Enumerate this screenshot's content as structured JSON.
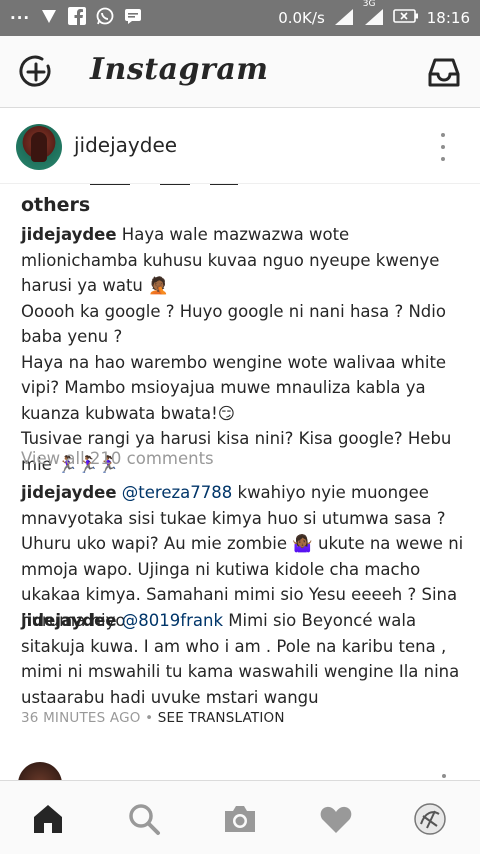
{
  "status_bar": {
    "left_icons": [
      "more-dots-icon",
      "shield-icon",
      "facebook-icon",
      "whatsapp-icon",
      "message-icon"
    ],
    "dots": "···",
    "network_speed": "0.0K/s",
    "network_type": "3G",
    "time": "18:16"
  },
  "app_bar": {
    "title": "Instagram",
    "left_icon": "new-post-icon",
    "right_icon": "inbox-icon"
  },
  "post": {
    "username": "jidejaydee",
    "liked_by_tail": "others",
    "caption": {
      "username": "jidejaydee",
      "lines": [
        "Haya wale mazwazwa wote mlionichamba kuhusu kuvaa nguo nyeupe kwenye harusi ya watu 🤦🏾",
        "Ooooh ka google ? Huyo google ni nani hasa ? Ndio baba yenu ?",
        "Haya na hao warembo wengine wote walivaa white vipi? Mambo msioyajua muwe mnauliza kabla ya kuanza kubwata bwata!😏",
        "Tusivae rangi ya harusi kisa nini? Kisa google? Hebu mie 🏃🏾‍♀️🏃🏾‍♀️🏃🏾‍♀️"
      ]
    },
    "view_all_comments": "View all 210 comments",
    "comments": [
      {
        "username": "jidejaydee",
        "mention": "@tereza7788",
        "text": " kwahiyo nyie muongee mnavyotaka sisi tukae kimya huo si utumwa sasa ? Uhuru uko wapi? Au mie zombie 🤷🏾‍♀️ ukute na wewe ni mmoja wapo. Ujinga ni kutiwa kidole cha macho ukakaa kimya. Samahani mimi sio Yesu eeeeh ? Sina huruma hiyo"
      },
      {
        "username": "jidejaydee",
        "mention": "@8019frank",
        "text": " Mimi sio Beyoncé wala sitakuja kuwa. I am who i am . Pole na karibu tena , mimi ni mswahili tu kama waswahili wengine Ila nina ustaarabu hadi uvuke mstari wangu"
      }
    ],
    "time_ago": "36 MINUTES AGO",
    "separator": "•",
    "see_translation": "SEE TRANSLATION"
  },
  "bottom_nav": {
    "tabs": [
      "home-icon",
      "search-icon",
      "camera-icon",
      "activity-heart-icon",
      "profile-avatar-icon"
    ]
  },
  "colors": {
    "status_bar": "#757575",
    "app_bar": "#fafafa",
    "text": "#262626",
    "muted": "#999999",
    "mention": "#003569"
  }
}
